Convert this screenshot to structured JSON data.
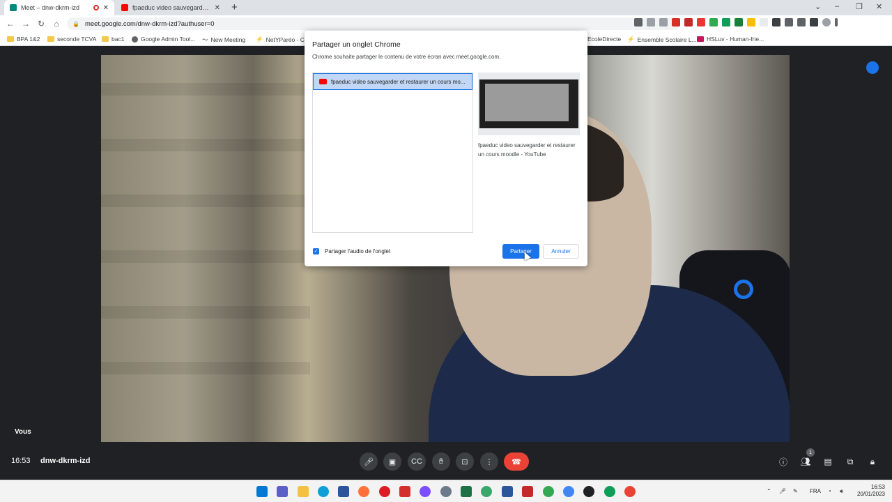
{
  "browser": {
    "tabs": [
      {
        "title": "Meet – dnw-dkrm-izd",
        "active": true,
        "recording": true
      },
      {
        "title": "fpaeduc video sauvegarder et re",
        "active": false
      }
    ],
    "new_tab": "+",
    "window_controls": [
      "⌄",
      "–",
      "❐",
      "✕"
    ],
    "url": "meet.google.com/dnw-dkrm-izd?authuser=0",
    "bookmarks": [
      "BPA 1&2",
      "seconde TCVA",
      "bac1",
      "Google Admin Tool...",
      "New Meeting",
      "NetYParéo - CFA",
      "EcoleDirecte",
      "Ensemble Scolaire L...",
      "HSLuv - Human-frie..."
    ]
  },
  "meet": {
    "self_label": "Vous",
    "time": "16:53",
    "meeting_code": "dnw-dkrm-izd",
    "participants_count": "1"
  },
  "dialog": {
    "title": "Partager un onglet Chrome",
    "subtitle": "Chrome souhaite partager le contenu de votre écran avec meet.google.com.",
    "selected_tab": "fpaeduc video sauvegarder et restaurer un cours mo...",
    "preview_caption": "fpaeduc video sauvegarder et restaurer un cours moodle - YouTube",
    "share_audio_label": "Partager l'audio de l'onglet",
    "share_audio_checked": true,
    "share_button": "Partager",
    "cancel_button": "Annuler"
  },
  "taskbar": {
    "language": "FRA",
    "time": "16:53",
    "date": "20/01/2023"
  },
  "colors": {
    "accent": "#1a73e8",
    "end_call": "#ea4335",
    "meet_bg": "#202124"
  }
}
